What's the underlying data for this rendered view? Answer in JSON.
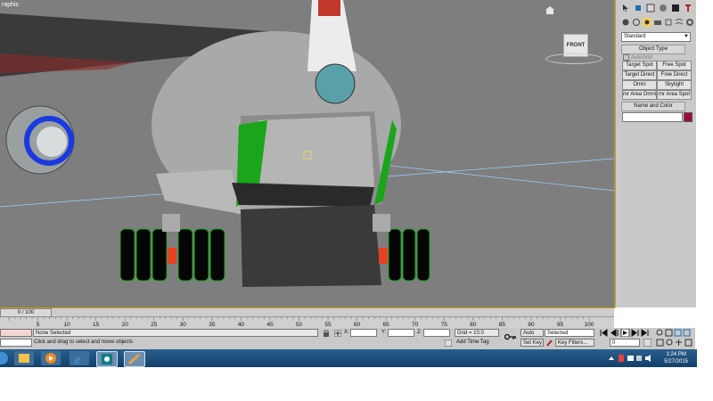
{
  "viewport": {
    "label": "raphic",
    "viewcube_label": "FRONT"
  },
  "command_panel": {
    "dropdown_value": "Standard",
    "rollouts": {
      "object_type": "Object Type",
      "name_color": "Name and Color"
    },
    "autogrid": "AutoGrid",
    "buttons": [
      "Target Spot",
      "Free Spot",
      "Target Direct",
      "Free Direct",
      "Omni",
      "Skylight",
      "mr Area Omni",
      "mr Area Spot"
    ],
    "swatch_color": "#9c0c3c"
  },
  "timeline": {
    "slider": "0 / 100",
    "ticks": [
      "5",
      "10",
      "15",
      "20",
      "25",
      "30",
      "35",
      "40",
      "45",
      "50",
      "55",
      "60",
      "65",
      "70",
      "75",
      "80",
      "85",
      "90",
      "95",
      "100"
    ]
  },
  "status": {
    "selection": "None Selected",
    "prompt": "Click and drag to select and move objects",
    "x_label": "X:",
    "y_label": "Y:",
    "z_label": "Z:",
    "grid": "Grid = 10.0",
    "add_time_tag": "Add Time Tag",
    "auto_key": "Auto Key",
    "set_key": "Set Key",
    "selected": "Selected",
    "key_filters": "Key Filters...",
    "frame": "0"
  },
  "taskbar": {
    "time": "1:24 PM",
    "date": "5/27/2015"
  }
}
